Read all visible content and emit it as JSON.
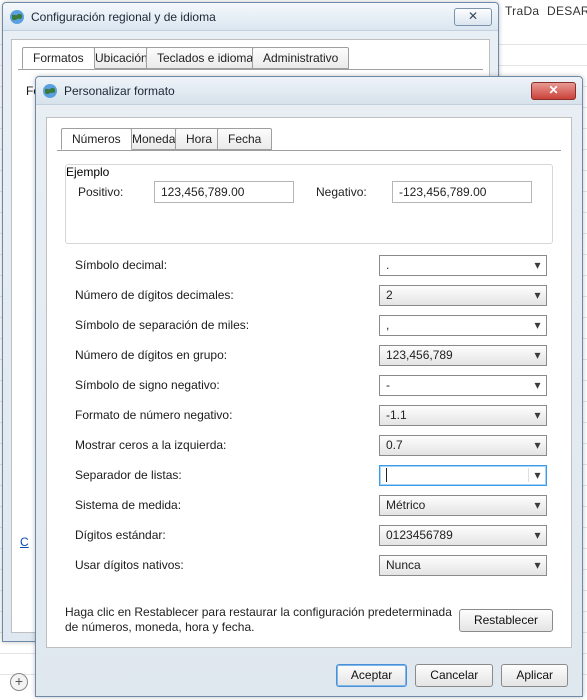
{
  "background": {
    "text1": "TraDa",
    "text2": "DESARRO",
    "plus": "+"
  },
  "win1": {
    "title": "Configuración regional y de idioma",
    "close_glyph": "✕",
    "tabs": {
      "t1": "Formatos",
      "t2": "Ubicación",
      "t3": "Teclados e idiomas",
      "t4": "Administrativo"
    },
    "format_label": "Formato:",
    "link_partial": "C"
  },
  "win2": {
    "title": "Personalizar formato",
    "close_glyph": "✕",
    "tabs": {
      "t1": "Números",
      "t2": "Moneda",
      "t3": "Hora",
      "t4": "Fecha"
    },
    "example": {
      "legend": "Ejemplo",
      "pos_label": "Positivo:",
      "pos_value": "123,456,789.00",
      "neg_label": "Negativo:",
      "neg_value": "-123,456,789.00"
    },
    "rows": {
      "decimal_symbol": {
        "label": "Símbolo decimal:",
        "value": "."
      },
      "decimal_digits": {
        "label": "Número de dígitos decimales:",
        "value": "2"
      },
      "thousands_sep": {
        "label": "Símbolo de separación de miles:",
        "value": ","
      },
      "digits_group": {
        "label": "Número de dígitos en grupo:",
        "value": "123,456,789"
      },
      "neg_symbol": {
        "label": "Símbolo de signo negativo:",
        "value": "-"
      },
      "neg_format": {
        "label": "Formato de número negativo:",
        "value": "-1.1"
      },
      "lead_zeros": {
        "label": "Mostrar ceros a la izquierda:",
        "value": "0.7"
      },
      "list_sep": {
        "label": "Separador de listas:",
        "value": ""
      },
      "measure": {
        "label": "Sistema de medida:",
        "value": "Métrico"
      },
      "std_digits": {
        "label": "Dígitos estándar:",
        "value": "0123456789"
      },
      "native_digits": {
        "label": "Usar dígitos nativos:",
        "value": "Nunca"
      }
    },
    "reset_text": "Haga clic en Restablecer para restaurar la configuración predeterminada de números, moneda, hora y fecha.",
    "reset_btn": "Restablecer",
    "ok": "Aceptar",
    "cancel": "Cancelar",
    "apply": "Aplicar"
  }
}
